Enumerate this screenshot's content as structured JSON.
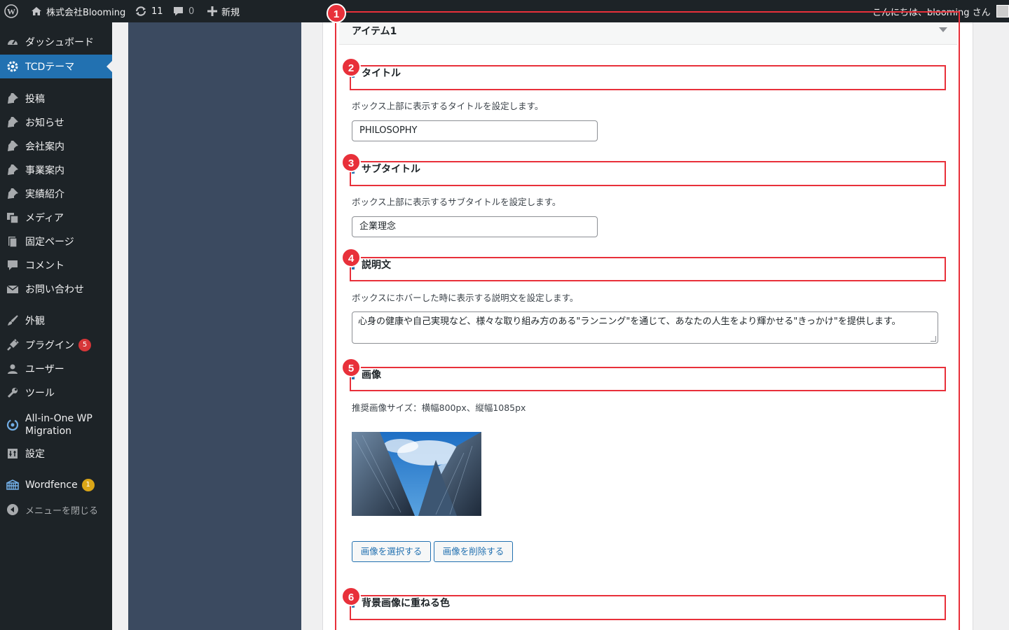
{
  "adminbar": {
    "site_name": "株式会社Blooming",
    "updates_count": "11",
    "comments_count": "0",
    "new_label": "新規",
    "greeting": "こんにちは、blooming さん"
  },
  "sidebar": {
    "items": [
      {
        "label": "ダッシュボード",
        "icon": "dashboard-icon"
      },
      {
        "label": "TCDテーマ",
        "icon": "gear-icon"
      },
      {
        "label": "投稿",
        "icon": "pin-icon"
      },
      {
        "label": "お知らせ",
        "icon": "pin-icon"
      },
      {
        "label": "会社案内",
        "icon": "pin-icon"
      },
      {
        "label": "事業案内",
        "icon": "pin-icon"
      },
      {
        "label": "実績紹介",
        "icon": "pin-icon"
      },
      {
        "label": "メディア",
        "icon": "media-icon"
      },
      {
        "label": "固定ページ",
        "icon": "page-icon"
      },
      {
        "label": "コメント",
        "icon": "comment-icon"
      },
      {
        "label": "お問い合わせ",
        "icon": "mail-icon"
      },
      {
        "label": "外観",
        "icon": "brush-icon"
      },
      {
        "label": "プラグイン",
        "icon": "plugin-icon",
        "badge": "5"
      },
      {
        "label": "ユーザー",
        "icon": "user-icon"
      },
      {
        "label": "ツール",
        "icon": "wrench-icon"
      },
      {
        "label": "All-in-One WP Migration",
        "icon": "migration-icon"
      },
      {
        "label": "設定",
        "icon": "settings-icon"
      },
      {
        "label": "Wordfence",
        "icon": "wordfence-icon",
        "badge": "1"
      },
      {
        "label": "メニューを閉じる",
        "icon": "collapse-icon"
      }
    ]
  },
  "item": {
    "title": "アイテム1"
  },
  "sections": {
    "title": {
      "heading": "タイトル",
      "description": "ボックス上部に表示するタイトルを設定します。",
      "value": "PHILOSOPHY"
    },
    "subtitle": {
      "heading": "サブタイトル",
      "description": "ボックス上部に表示するサブタイトルを設定します。",
      "value": "企業理念"
    },
    "description": {
      "heading": "説明文",
      "description": "ボックスにホバーした時に表示する説明文を設定します。",
      "value": "心身の健康や自己実現など、様々な取り組み方のある\"ランニング\"を通じて、あなたの人生をより輝かせる\"きっかけ\"を提供します。"
    },
    "image": {
      "heading": "画像",
      "description": "推奨画像サイズ：横幅800px、縦幅1085px",
      "select_button": "画像を選択する",
      "delete_button": "画像を削除する"
    },
    "overlay_color": {
      "heading": "背景画像に重ねる色"
    }
  },
  "annotations": [
    "1",
    "2",
    "3",
    "4",
    "5",
    "6"
  ],
  "colors": {
    "accent": "#2271b1",
    "annotation": "#e8303a",
    "sidebar_bg": "#1d2327"
  }
}
